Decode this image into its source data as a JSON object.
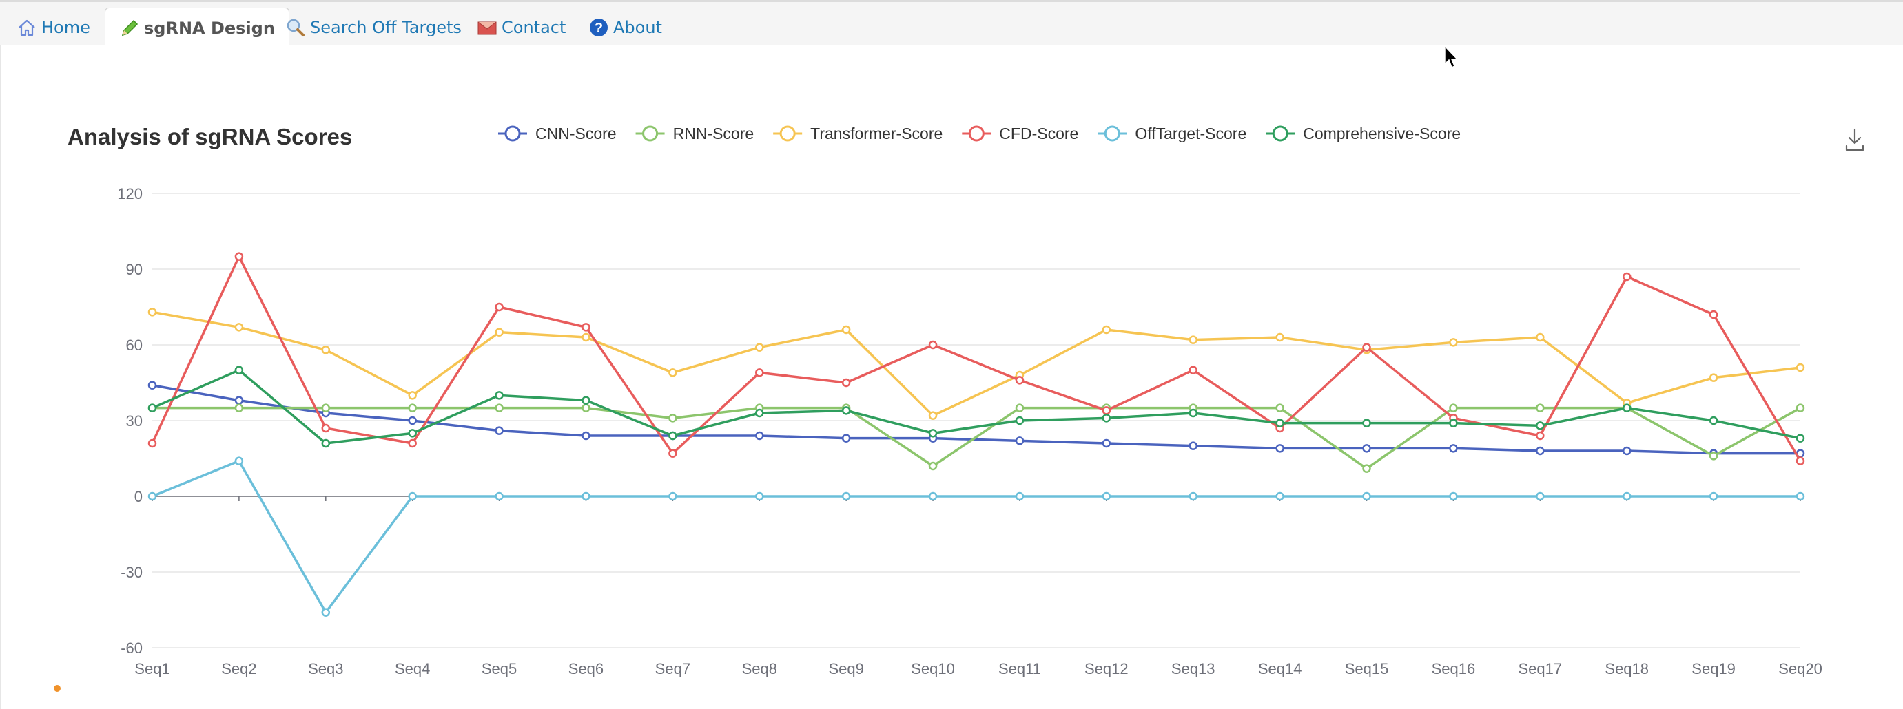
{
  "nav": {
    "tabs": [
      {
        "label": "Home",
        "icon": "home-icon",
        "active": false
      },
      {
        "label": "sgRNA Design",
        "icon": "pencil-icon",
        "active": true
      },
      {
        "label": "Search Off Targets",
        "icon": "magnifier-icon",
        "active": false
      },
      {
        "label": "Contact",
        "icon": "envelope-icon",
        "active": false
      },
      {
        "label": "About",
        "icon": "question-icon",
        "active": false
      }
    ]
  },
  "colors": {
    "tab_link": "#1e78b4",
    "tab_active": "#555555"
  },
  "chart_data": {
    "type": "line",
    "title": "Analysis of sgRNA Scores",
    "legend_position": "top",
    "grid": true,
    "ylim": [
      -60,
      120
    ],
    "yticks": [
      120,
      90,
      60,
      30,
      0,
      -30,
      -60
    ],
    "x": [
      "Seq1",
      "Seq2",
      "Seq3",
      "Seq4",
      "Seq5",
      "Seq6",
      "Seq7",
      "Seq8",
      "Seq9",
      "Seq10",
      "Seq11",
      "Seq12",
      "Seq13",
      "Seq14",
      "Seq15",
      "Seq16",
      "Seq17",
      "Seq18",
      "Seq19",
      "Seq20"
    ],
    "series": [
      {
        "name": "CNN-Score",
        "color": "#4a63be",
        "values": [
          44,
          38,
          33,
          30,
          26,
          24,
          24,
          24,
          23,
          23,
          22,
          21,
          20,
          19,
          19,
          19,
          18,
          18,
          17,
          17
        ]
      },
      {
        "name": "RNN-Score",
        "color": "#8cc56c",
        "values": [
          35,
          35,
          35,
          35,
          35,
          35,
          31,
          35,
          35,
          12,
          35,
          35,
          35,
          35,
          11,
          35,
          35,
          35,
          16,
          35
        ]
      },
      {
        "name": "Transformer-Score",
        "color": "#f6c452",
        "values": [
          73,
          67,
          58,
          40,
          65,
          63,
          49,
          59,
          66,
          32,
          48,
          66,
          62,
          63,
          58,
          61,
          63,
          37,
          47,
          51
        ]
      },
      {
        "name": "CFD-Score",
        "color": "#e85c5c",
        "values": [
          21,
          95,
          27,
          21,
          75,
          67,
          17,
          49,
          45,
          60,
          46,
          34,
          50,
          27,
          59,
          31,
          24,
          87,
          72,
          14
        ]
      },
      {
        "name": "OffTarget-Score",
        "color": "#6bbfda",
        "values": [
          0,
          14,
          -46,
          0,
          0,
          0,
          0,
          0,
          0,
          0,
          0,
          0,
          0,
          0,
          0,
          0,
          0,
          0,
          0,
          0
        ]
      },
      {
        "name": "Comprehensive-Score",
        "color": "#2f9e5e",
        "values": [
          35,
          50,
          21,
          25,
          40,
          38,
          24,
          33,
          34,
          25,
          30,
          31,
          33,
          29,
          29,
          29,
          28,
          35,
          30,
          23
        ]
      }
    ]
  }
}
